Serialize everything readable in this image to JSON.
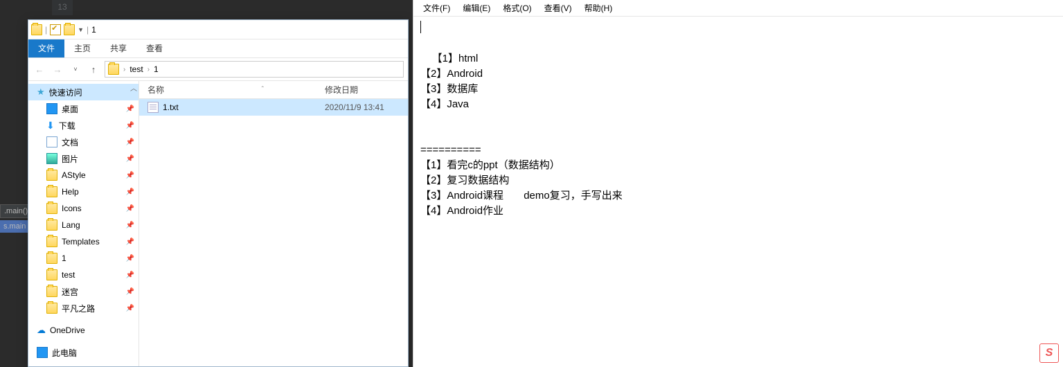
{
  "bg": {
    "line_number": "13",
    "tab1": ".main()",
    "tab2": "s.main"
  },
  "explorer": {
    "title_suffix": "1",
    "ribbon": {
      "file": "文件",
      "home": "主页",
      "share": "共享",
      "view": "查看"
    },
    "path": {
      "seg1": "test",
      "seg2": "1"
    },
    "tree": {
      "quick": "快速访问",
      "desktop": "桌面",
      "downloads": "下载",
      "documents": "文档",
      "pictures": "图片",
      "astyle": "AStyle",
      "help": "Help",
      "icons": "Icons",
      "lang": "Lang",
      "templates": "Templates",
      "one": "1",
      "test": "test",
      "maze": "迷宫",
      "pingfan": "平凡之路",
      "onedrive": "OneDrive",
      "thispc": "此电脑"
    },
    "columns": {
      "name": "名称",
      "date": "修改日期"
    },
    "rows": [
      {
        "name": "1.txt",
        "date": "2020/11/9 13:41"
      }
    ]
  },
  "notepad": {
    "menu": {
      "file": "文件(F)",
      "edit": "编辑(E)",
      "format": "格式(O)",
      "view": "查看(V)",
      "help": "帮助(H)"
    },
    "content": "【1】html\n【2】Android\n【3】数据库\n【4】Java\n\n\n==========\n【1】看完c的ppt（数据结构）\n【2】复习数据结构\n【3】Android课程       demo复习，手写出来\n【4】Android作业"
  },
  "ime": {
    "label": "S"
  }
}
